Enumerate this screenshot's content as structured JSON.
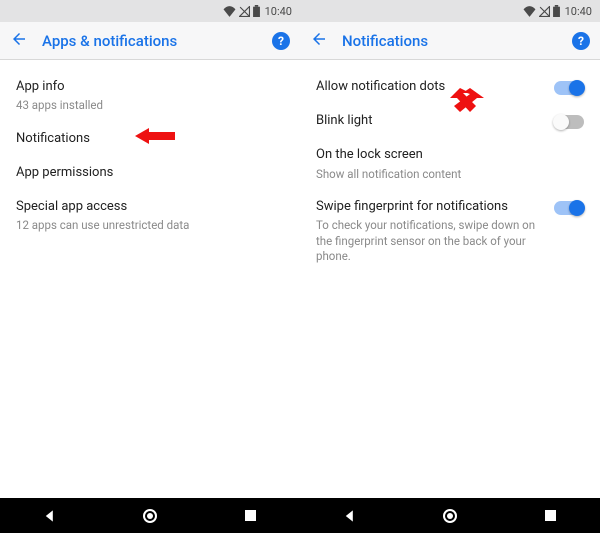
{
  "status": {
    "time": "10:40"
  },
  "colors": {
    "accent": "#1a73e8"
  },
  "left": {
    "title": "Apps & notifications",
    "rows": [
      {
        "title": "App info",
        "sub": "43 apps installed"
      },
      {
        "title": "Notifications"
      },
      {
        "title": "App permissions"
      },
      {
        "title": "Special app access",
        "sub": "12 apps can use unrestricted data"
      }
    ]
  },
  "right": {
    "title": "Notifications",
    "rows": [
      {
        "title": "Allow notification dots",
        "toggle": true,
        "on": true
      },
      {
        "title": "Blink light",
        "toggle": true,
        "on": false
      },
      {
        "title": "On the lock screen",
        "sub": "Show all notification content"
      },
      {
        "title": "Swipe fingerprint for notifications",
        "sub": "To check your notifications, swipe down on the fingerprint sensor on the back of your phone.",
        "toggle": true,
        "on": true
      }
    ]
  },
  "help_symbol": "?"
}
